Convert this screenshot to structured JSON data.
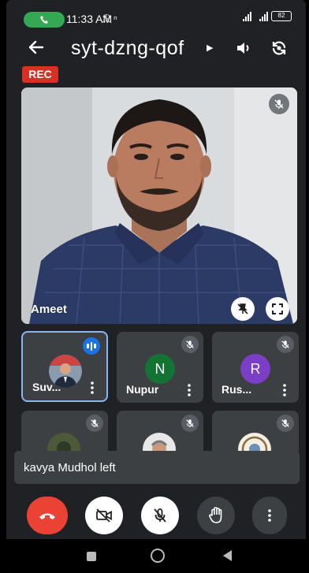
{
  "status_bar": {
    "time": "11:33 AM",
    "extra": "ℛ ⁿ",
    "battery": "82"
  },
  "header": {
    "meeting_code": "syt-dzng-qof"
  },
  "recording_badge": "REC",
  "main_participant": {
    "name": "Ameet"
  },
  "participants": [
    {
      "name": "Suv...",
      "type": "photo",
      "speaking": true
    },
    {
      "name": "Nupur",
      "type": "initial",
      "initial": "N",
      "color": "#137333"
    },
    {
      "name": "Rus...",
      "type": "initial",
      "initial": "R",
      "color": "#7b3fc7"
    },
    {
      "name": "",
      "type": "photo"
    },
    {
      "name": "",
      "type": "photo"
    },
    {
      "name": "",
      "type": "photo"
    }
  ],
  "toast": {
    "message": "kavya Mudhol left"
  },
  "colors": {
    "background": "#202124",
    "tile": "#3c4043",
    "end_call": "#ea4335",
    "rec": "#d93025",
    "active_border": "#8ab4f8"
  },
  "icons": [
    "back-arrow-icon",
    "speaker-icon",
    "switch-camera-icon",
    "mic-off-icon",
    "pin-off-icon",
    "fullscreen-icon",
    "speaking-icon",
    "more-vert-icon",
    "end-call-icon",
    "camera-off-icon",
    "raise-hand-icon"
  ]
}
